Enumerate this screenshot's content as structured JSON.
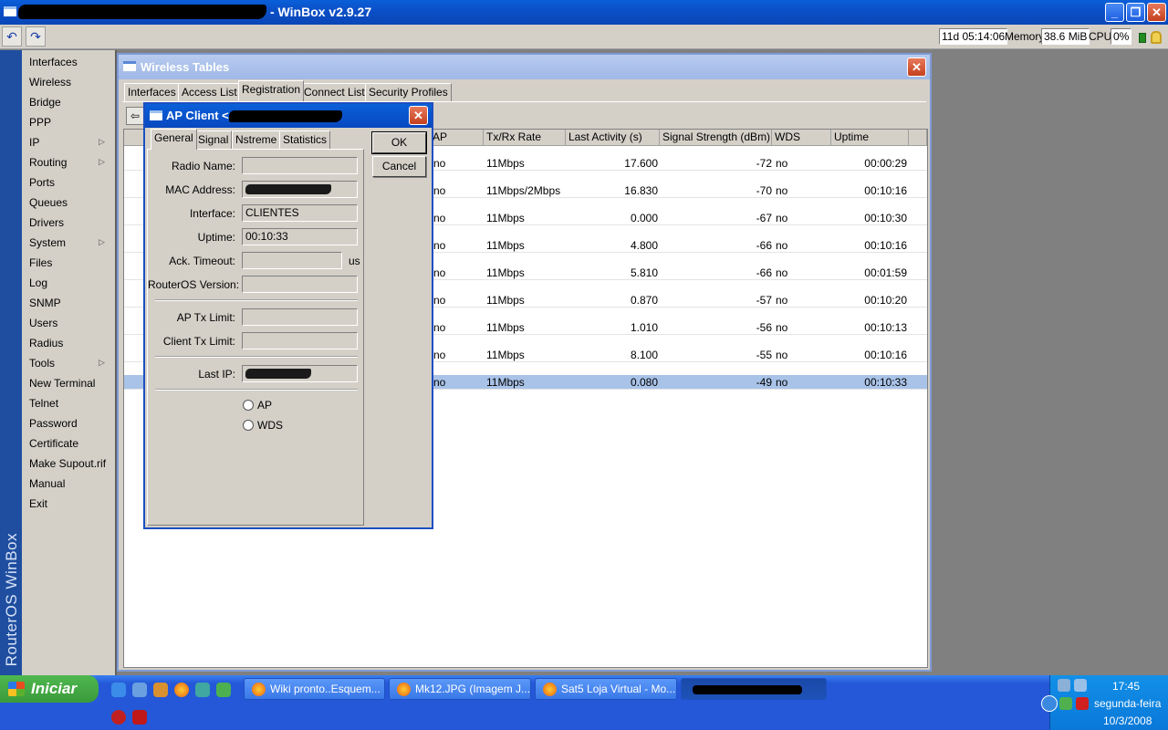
{
  "app": {
    "title": "- WinBox v2.9.27"
  },
  "status": {
    "uptime": "11d 05:14:06",
    "memory_label": "Memory:",
    "memory": "38.6 MiB",
    "cpu_label": "CPU:",
    "cpu": "0%"
  },
  "sidebar": {
    "brand": "RouterOS WinBox",
    "items": [
      "Interfaces",
      "Wireless",
      "Bridge",
      "PPP",
      "IP",
      "Routing",
      "Ports",
      "Queues",
      "Drivers",
      "System",
      "Files",
      "Log",
      "SNMP",
      "Users",
      "Radius",
      "Tools",
      "New Terminal",
      "Telnet",
      "Password",
      "Certificate",
      "Make Supout.rif",
      "Manual",
      "Exit"
    ]
  },
  "wireless_tables": {
    "title": "Wireless Tables",
    "tabs": [
      "Interfaces",
      "Access List",
      "Registration",
      "Connect List",
      "Security Profiles"
    ],
    "columns": [
      "AP",
      "Tx/Rx Rate",
      "Last Activity (s)",
      "Signal Strength (dBm)",
      "WDS",
      "Uptime"
    ],
    "sort_indicator": "/",
    "rows": [
      {
        "ap": "no",
        "rate": "11Mbps",
        "activity": "17.600",
        "signal": "-72",
        "wds": "no",
        "uptime": "00:00:29"
      },
      {
        "ap": "no",
        "rate": "11Mbps/2Mbps",
        "activity": "16.830",
        "signal": "-70",
        "wds": "no",
        "uptime": "00:10:16"
      },
      {
        "ap": "no",
        "rate": "11Mbps",
        "activity": "0.000",
        "signal": "-67",
        "wds": "no",
        "uptime": "00:10:30"
      },
      {
        "ap": "no",
        "rate": "11Mbps",
        "activity": "4.800",
        "signal": "-66",
        "wds": "no",
        "uptime": "00:10:16"
      },
      {
        "ap": "no",
        "rate": "11Mbps",
        "activity": "5.810",
        "signal": "-66",
        "wds": "no",
        "uptime": "00:01:59"
      },
      {
        "ap": "no",
        "rate": "11Mbps",
        "activity": "0.870",
        "signal": "-57",
        "wds": "no",
        "uptime": "00:10:20"
      },
      {
        "ap": "no",
        "rate": "11Mbps",
        "activity": "1.010",
        "signal": "-56",
        "wds": "no",
        "uptime": "00:10:13"
      },
      {
        "ap": "no",
        "rate": "11Mbps",
        "activity": "8.100",
        "signal": "-55",
        "wds": "no",
        "uptime": "00:10:16"
      },
      {
        "ap": "no",
        "rate": "11Mbps",
        "activity": "0.080",
        "signal": "-49",
        "wds": "no",
        "uptime": "00:10:33"
      }
    ]
  },
  "dialog": {
    "title": "AP Client <",
    "tabs": [
      "General",
      "Signal",
      "Nstreme",
      "Statistics"
    ],
    "labels": {
      "radio_name": "Radio Name:",
      "mac_address": "MAC Address:",
      "interface": "Interface:",
      "uptime": "Uptime:",
      "ack_timeout": "Ack. Timeout:",
      "routeros_version": "RouterOS Version:",
      "ap_tx_limit": "AP Tx Limit:",
      "client_tx_limit": "Client Tx Limit:",
      "last_ip": "Last IP:"
    },
    "values": {
      "interface": "CLIENTES",
      "uptime": "00:10:33",
      "ack_unit": "us"
    },
    "radios": {
      "ap": "AP",
      "wds": "WDS"
    },
    "ok": "OK",
    "cancel": "Cancel"
  },
  "taskbar": {
    "start": "Iniciar",
    "tasks": [
      "Wiki pronto..Esquem...",
      "Mk12.JPG (Imagem J...",
      "Sat5 Loja Virtual - Mo..."
    ],
    "tray_time": "17:45",
    "tray_day": "segunda-feira",
    "tray_date": "10/3/2008"
  }
}
